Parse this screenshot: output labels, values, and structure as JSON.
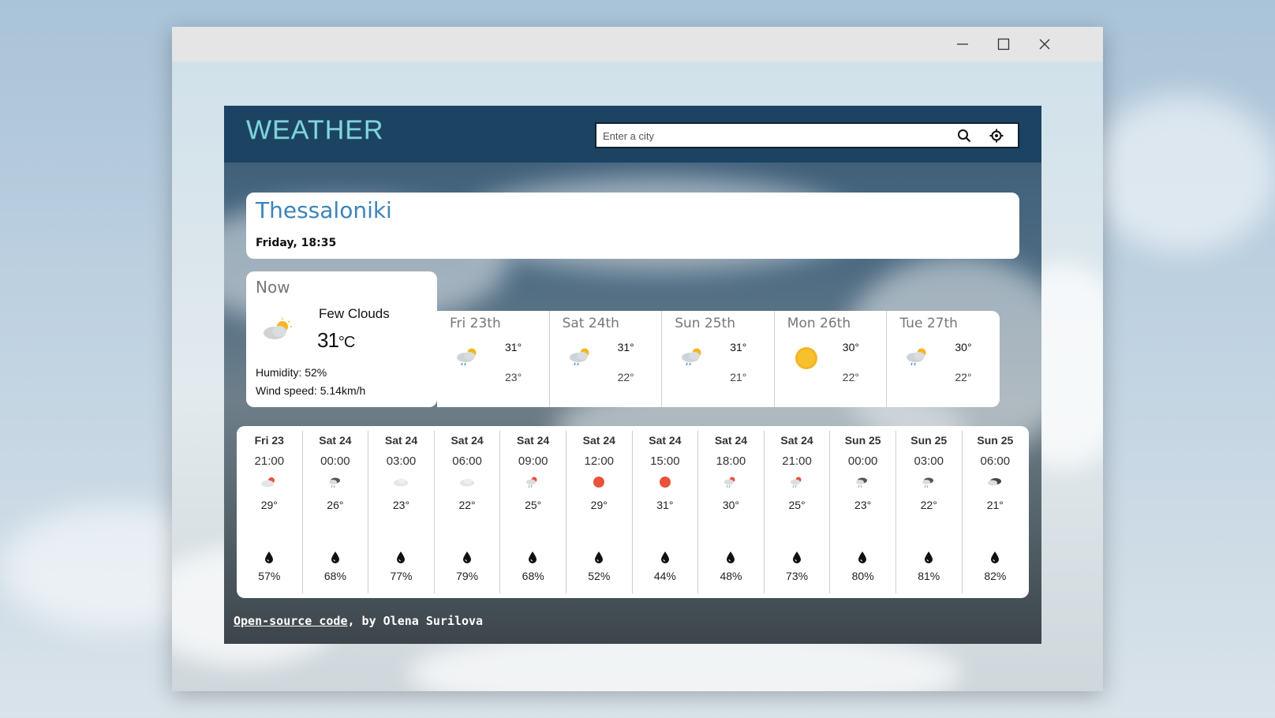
{
  "window": {
    "minimize_icon": "minimize-icon",
    "maximize_icon": "maximize-icon",
    "close_icon": "close-icon"
  },
  "header": {
    "logo": "WEATHER",
    "search_placeholder": "Enter a city",
    "search_icon": "search-icon",
    "location_icon": "location-crosshair-icon"
  },
  "city": {
    "name": "Thessaloniki",
    "datetime": "Friday, 18:35"
  },
  "now": {
    "title": "Now",
    "icon": "few-clouds-icon",
    "description": "Few Clouds",
    "temp": "31",
    "unit": "°C",
    "humidity": "Humidity: 52%",
    "wind": "Wind speed: 5.14km/h"
  },
  "daily": [
    {
      "day": "Fri 23th",
      "icon": "rain-sun-cloud-icon",
      "max": "31°",
      "min": "23°"
    },
    {
      "day": "Sat 24th",
      "icon": "rain-sun-cloud-icon",
      "max": "31°",
      "min": "22°"
    },
    {
      "day": "Sun 25th",
      "icon": "rain-sun-cloud-icon",
      "max": "31°",
      "min": "21°"
    },
    {
      "day": "Mon 26th",
      "icon": "sun-icon",
      "max": "30°",
      "min": "22°"
    },
    {
      "day": "Tue 27th",
      "icon": "rain-sun-cloud-icon",
      "max": "30°",
      "min": "22°"
    }
  ],
  "hourly": [
    {
      "day": "Fri 23",
      "time": "21:00",
      "icon": "cloud-sun-icon",
      "temp": "29°",
      "rain": "57%"
    },
    {
      "day": "Sat 24",
      "time": "00:00",
      "icon": "rain-cloud-icon",
      "temp": "26°",
      "rain": "68%"
    },
    {
      "day": "Sat 24",
      "time": "03:00",
      "icon": "cloud-icon",
      "temp": "23°",
      "rain": "77%"
    },
    {
      "day": "Sat 24",
      "time": "06:00",
      "icon": "cloud-icon",
      "temp": "22°",
      "rain": "79%"
    },
    {
      "day": "Sat 24",
      "time": "09:00",
      "icon": "rain-sun-icon",
      "temp": "25°",
      "rain": "68%"
    },
    {
      "day": "Sat 24",
      "time": "12:00",
      "icon": "sun-icon",
      "temp": "29°",
      "rain": "52%"
    },
    {
      "day": "Sat 24",
      "time": "15:00",
      "icon": "sun-icon",
      "temp": "31°",
      "rain": "44%"
    },
    {
      "day": "Sat 24",
      "time": "18:00",
      "icon": "rain-sun-icon",
      "temp": "30°",
      "rain": "48%"
    },
    {
      "day": "Sat 24",
      "time": "21:00",
      "icon": "rain-sun-icon",
      "temp": "25°",
      "rain": "73%"
    },
    {
      "day": "Sun 25",
      "time": "00:00",
      "icon": "rain-cloud-icon",
      "temp": "23°",
      "rain": "80%"
    },
    {
      "day": "Sun 25",
      "time": "03:00",
      "icon": "rain-cloud-icon",
      "temp": "22°",
      "rain": "81%"
    },
    {
      "day": "Sun 25",
      "time": "06:00",
      "icon": "dark-cloud-icon",
      "temp": "21°",
      "rain": "82%"
    }
  ],
  "footer": {
    "link": "Open-source code",
    "author": ", by Olena Surilova"
  },
  "colors": {
    "header_bg": "#1c4361",
    "city_name": "#3b85b8",
    "logo": "#8fd3dc",
    "sun": "#f4b622",
    "sun_small": "#e8533a"
  }
}
